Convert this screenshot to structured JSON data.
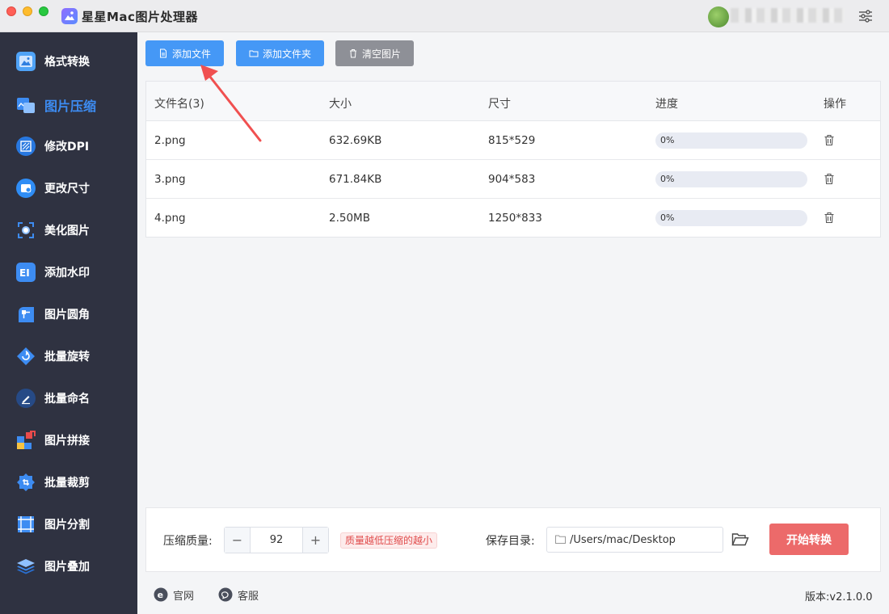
{
  "window": {
    "title": "星星Mac图片处理器"
  },
  "sidebar": {
    "items": [
      {
        "label": "格式转换",
        "icon": "format-convert-icon",
        "active": false
      },
      {
        "label": "图片压缩",
        "icon": "image-compress-icon",
        "active": true
      },
      {
        "label": "修改DPI",
        "icon": "dpi-icon",
        "active": false
      },
      {
        "label": "更改尺寸",
        "icon": "resize-icon",
        "active": false
      },
      {
        "label": "美化图片",
        "icon": "beautify-icon",
        "active": false
      },
      {
        "label": "添加水印",
        "icon": "watermark-icon",
        "active": false
      },
      {
        "label": "图片圆角",
        "icon": "rounded-corner-icon",
        "active": false
      },
      {
        "label": "批量旋转",
        "icon": "rotate-icon",
        "active": false
      },
      {
        "label": "批量命名",
        "icon": "rename-icon",
        "active": false
      },
      {
        "label": "图片拼接",
        "icon": "stitch-icon",
        "active": false
      },
      {
        "label": "批量裁剪",
        "icon": "crop-icon",
        "active": false
      },
      {
        "label": "图片分割",
        "icon": "split-icon",
        "active": false
      },
      {
        "label": "图片叠加",
        "icon": "overlay-icon",
        "active": false
      }
    ]
  },
  "toolbar": {
    "add_file": "添加文件",
    "add_folder": "添加文件夹",
    "clear": "清空图片"
  },
  "table": {
    "headers": [
      "文件名(3)",
      "大小",
      "尺寸",
      "进度",
      "操作"
    ],
    "rows": [
      {
        "name": "2.png",
        "size": "632.69KB",
        "dims": "815*529",
        "progress": "0%"
      },
      {
        "name": "3.png",
        "size": "671.84KB",
        "dims": "904*583",
        "progress": "0%"
      },
      {
        "name": "4.png",
        "size": "2.50MB",
        "dims": "1250*833",
        "progress": "0%"
      }
    ]
  },
  "settings": {
    "quality_label": "压缩质量:",
    "quality_value": "92",
    "minus": "−",
    "plus": "+",
    "hint": "质量越低压缩的越小",
    "save_label": "保存目录:",
    "save_path": "/Users/mac/Desktop",
    "start": "开始转换"
  },
  "footer": {
    "website": "官网",
    "support": "客服",
    "version": "版本:v2.1.0.0"
  },
  "colors": {
    "accent": "#4598f6",
    "sidebar_bg": "#2f3241",
    "active_item": "#3d8cf2",
    "start_button": "#ec6a6a",
    "annotation_arrow": "#f05050"
  }
}
